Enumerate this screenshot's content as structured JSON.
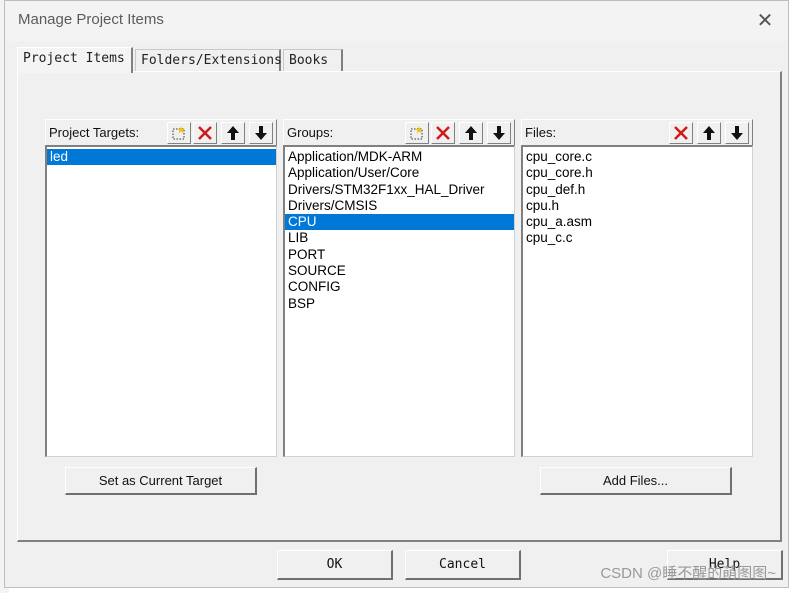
{
  "dialog": {
    "title": "Manage Project Items",
    "close_label": "✕"
  },
  "tabs": [
    {
      "label": "Project Items"
    },
    {
      "label": "Folders/Extensions"
    },
    {
      "label": "Books"
    }
  ],
  "targets": {
    "title": "Project Targets:",
    "items": [
      "led"
    ],
    "selected": "led"
  },
  "groups": {
    "title": "Groups:",
    "items": [
      "Application/MDK-ARM",
      "Application/User/Core",
      "Drivers/STM32F1xx_HAL_Driver",
      "Drivers/CMSIS",
      "CPU",
      "LIB",
      "PORT",
      "SOURCE",
      "CONFIG",
      "BSP"
    ],
    "selected": "CPU"
  },
  "files": {
    "title": "Files:",
    "items": [
      "cpu_core.c",
      "cpu_core.h",
      "cpu_def.h",
      "cpu.h",
      "cpu_a.asm",
      "cpu_c.c"
    ]
  },
  "buttons": {
    "set_current_target": "Set as Current Target",
    "add_files": "Add Files...",
    "ok": "OK",
    "cancel": "Cancel",
    "help": "Help"
  },
  "icons": {
    "new": "new-item-icon",
    "delete": "delete-icon",
    "up": "move-up-icon",
    "down": "move-down-icon"
  },
  "colors": {
    "selection": "#0078d7",
    "delete_red": "#d11a1a"
  },
  "watermark": "CSDN @睡不醒的萌图图~"
}
